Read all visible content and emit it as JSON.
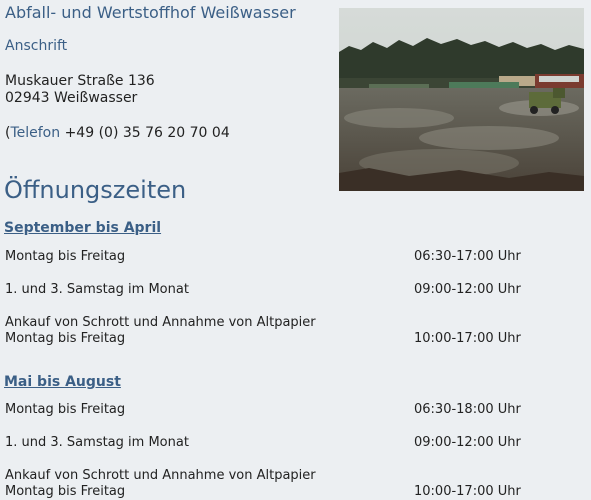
{
  "header": {
    "title": "Abfall- und Wertstoffhof Weißwasser",
    "address_link": "Anschrift",
    "street": "Muskauer Straße 136",
    "city": "02943 Weißwasser",
    "phone_paren": "(",
    "phone_label": "Telefon",
    "phone_number": " +49 (0) 35 76 20 70 04"
  },
  "photo": {
    "icon": "landfill-photo"
  },
  "hours": {
    "heading": "Öffnungszeiten",
    "sections": [
      {
        "title": "September bis April",
        "rows": [
          {
            "label": "Montag bis Freitag",
            "time": "06:30-17:00 Uhr"
          },
          {
            "label": "1. und 3. Samstag im Monat",
            "time": "09:00-12:00 Uhr"
          },
          {
            "label": "Ankauf von Schrott und Annahme von Altpapier",
            "label2": "Montag bis Freitag",
            "time": "10:00-17:00 Uhr"
          }
        ]
      },
      {
        "title": "Mai bis August",
        "rows": [
          {
            "label": "Montag bis Freitag",
            "time": "06:30-18:00 Uhr"
          },
          {
            "label": "1. und 3. Samstag im Monat",
            "time": "09:00-12:00 Uhr"
          },
          {
            "label": "Ankauf von Schrott und Annahme von Altpapier",
            "label2": "Montag bis Freitag",
            "time": "10:00-17:00 Uhr"
          }
        ]
      }
    ]
  }
}
